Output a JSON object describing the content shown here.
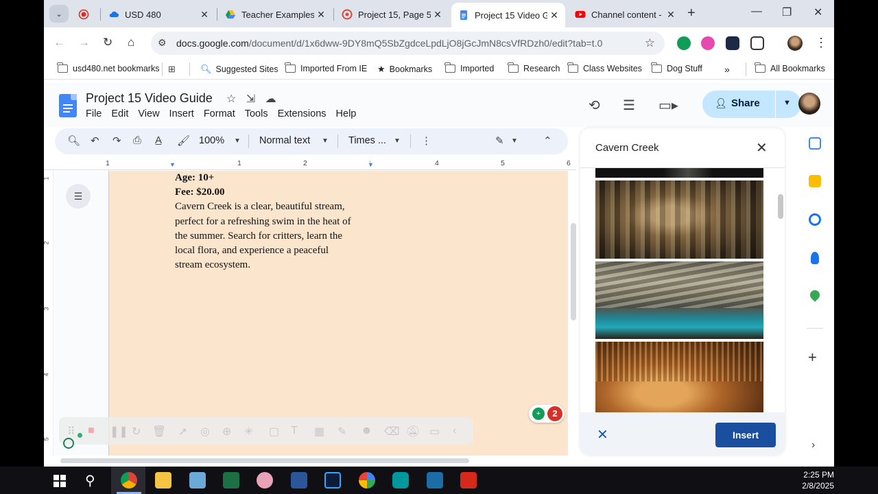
{
  "browser": {
    "tabs": [
      {
        "title": "",
        "icon": "record-icon",
        "active": false
      },
      {
        "title": "USD 480",
        "icon": "cloud-icon",
        "active": false
      },
      {
        "title": "Teacher Examples",
        "icon": "drive-icon",
        "active": false
      },
      {
        "title": "Project 15, Page 5",
        "icon": "app-icon",
        "active": false
      },
      {
        "title": "Project 15 Video G",
        "icon": "docs-icon",
        "active": true
      },
      {
        "title": "Channel content -",
        "icon": "youtube-icon",
        "active": false
      }
    ],
    "url_host": "docs.google.com",
    "url_path": "/document/d/1x6dww-9DY8mQ5SbZgdceLpdLjO8jGcJmN8csVfRDzh0/edit?tab=t.0",
    "bookmarks": [
      {
        "label": "usd480.net bookmarks",
        "icon": "folder-icon"
      },
      {
        "label": "",
        "icon": "apps-grid-icon"
      },
      {
        "label": "Suggested Sites",
        "icon": "search-icon"
      },
      {
        "label": "Imported From IE",
        "icon": "folder-icon"
      },
      {
        "label": "Bookmarks",
        "icon": "star-icon"
      },
      {
        "label": "Imported",
        "icon": "folder-icon"
      },
      {
        "label": "Research",
        "icon": "folder-icon"
      },
      {
        "label": "Class Websites",
        "icon": "folder-icon"
      },
      {
        "label": "Dog Stuff",
        "icon": "folder-icon"
      }
    ],
    "all_bookmarks": "All Bookmarks"
  },
  "docs": {
    "title": "Project 15 Video Guide",
    "menu": [
      "File",
      "Edit",
      "View",
      "Insert",
      "Format",
      "Tools",
      "Extensions",
      "Help"
    ],
    "share_label": "Share",
    "toolbar": {
      "zoom": "100%",
      "style": "Normal text",
      "font": "Times ..."
    },
    "ruler_numbers": [
      "1",
      "1",
      "2",
      "3",
      "4",
      "5",
      "6"
    ],
    "vruler_numbers": [
      "1",
      "2",
      "3",
      "4",
      "5"
    ],
    "content": {
      "age": "Age: 10+",
      "fee": "Fee: $20.00",
      "lines": [
        "Cavern Creek is a clear, beautiful stream,",
        "perfect for a refreshing swim in the heat of",
        "the summer. Search for critters, learn the",
        "local flora, and experience a peaceful",
        "stream ecosystem."
      ]
    },
    "comment_count": "2",
    "page_bg": "#fce5cd"
  },
  "panel": {
    "search_query": "Cavern Creek",
    "insert_label": "Insert"
  },
  "taskbar": {
    "time": "2:25 PM",
    "date": "2/8/2025",
    "apps": [
      "windows-start-icon",
      "search-icon",
      "chrome-icon",
      "file-explorer-icon",
      "calculator-icon",
      "excel-icon",
      "paint-icon",
      "word-icon",
      "photoshop-icon",
      "chrome-alt-icon",
      "arduino-icon",
      "sketchup-icon",
      "acrobat-icon"
    ]
  },
  "colors": {
    "accent": "#0b57d0",
    "share_bg": "#c2e7ff",
    "insert_bg": "#1a4fa0"
  }
}
